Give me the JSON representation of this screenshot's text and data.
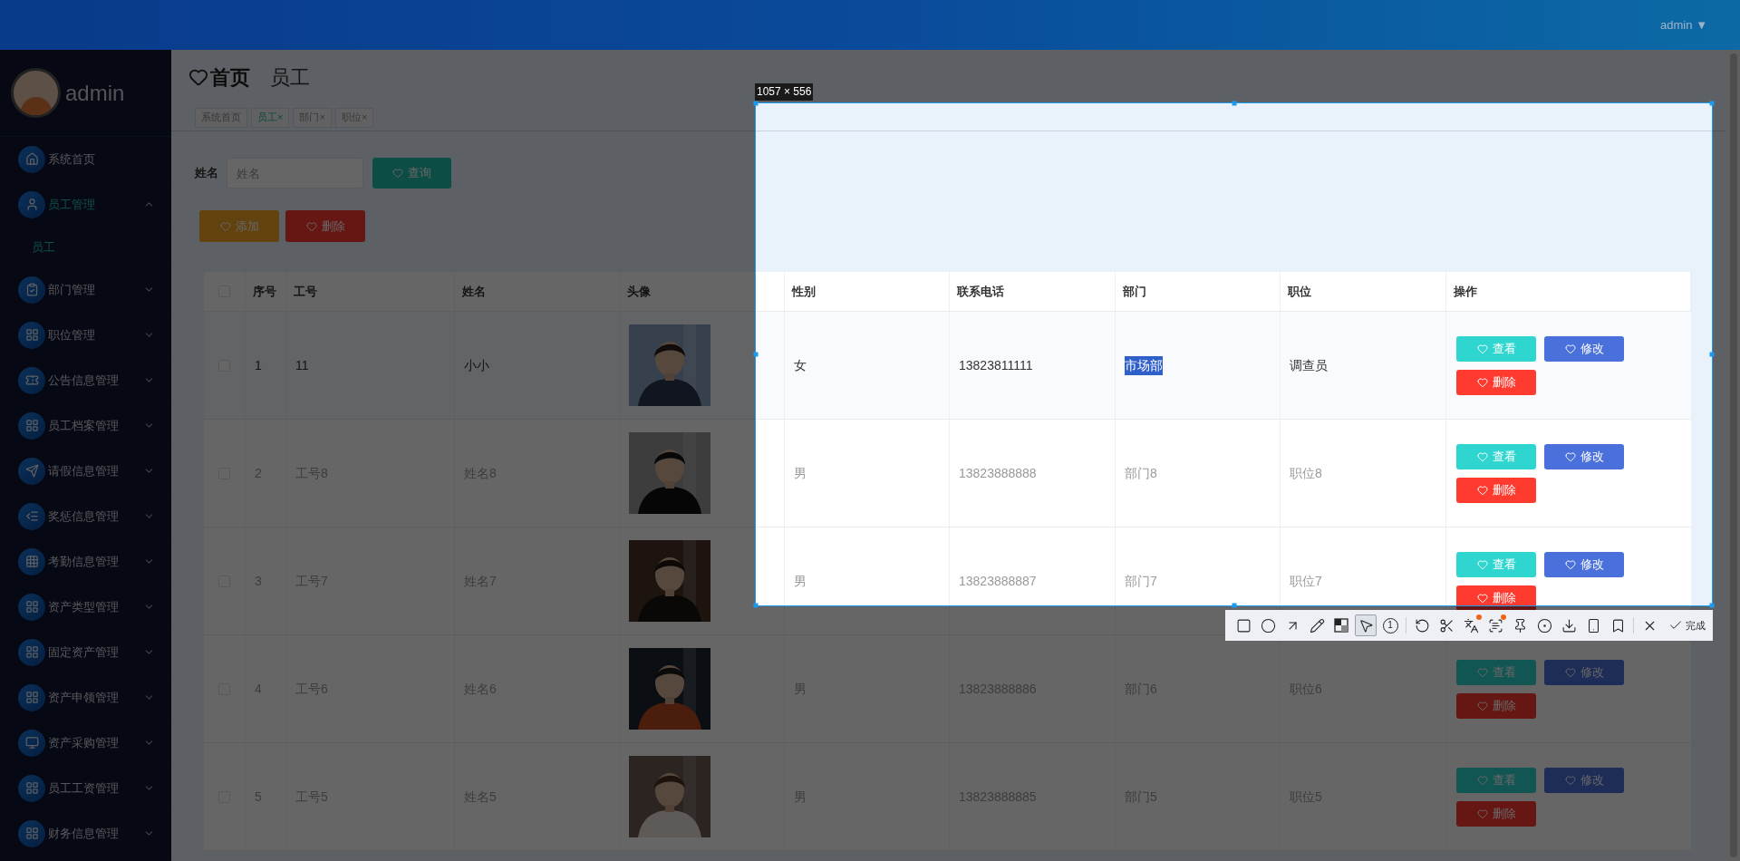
{
  "topbar": {
    "user": "admin",
    "caret": "▼"
  },
  "sidebar": {
    "username": "admin",
    "items": [
      {
        "label": "系统首页",
        "kind": "home",
        "expandable": false,
        "expanded": false,
        "selected": false
      },
      {
        "label": "员工管理",
        "kind": "user",
        "expandable": true,
        "expanded": true,
        "selected": true,
        "children": [
          {
            "label": "员工",
            "selected": true
          }
        ]
      },
      {
        "label": "部门管理",
        "kind": "clipboard",
        "expandable": true,
        "expanded": false,
        "selected": false
      },
      {
        "label": "职位管理",
        "kind": "grid",
        "expandable": true,
        "expanded": false,
        "selected": false
      },
      {
        "label": "公告信息管理",
        "kind": "ticket",
        "expandable": true,
        "expanded": false,
        "selected": false
      },
      {
        "label": "员工档案管理",
        "kind": "grid",
        "expandable": true,
        "expanded": false,
        "selected": false
      },
      {
        "label": "请假信息管理",
        "kind": "send",
        "expandable": true,
        "expanded": false,
        "selected": false
      },
      {
        "label": "奖惩信息管理",
        "kind": "list",
        "expandable": true,
        "expanded": false,
        "selected": false
      },
      {
        "label": "考勤信息管理",
        "kind": "grid9",
        "expandable": true,
        "expanded": false,
        "selected": false
      },
      {
        "label": "资产类型管理",
        "kind": "grid",
        "expandable": true,
        "expanded": false,
        "selected": false
      },
      {
        "label": "固定资产管理",
        "kind": "grid",
        "expandable": true,
        "expanded": false,
        "selected": false
      },
      {
        "label": "资产申领管理",
        "kind": "grid",
        "expandable": true,
        "expanded": false,
        "selected": false
      },
      {
        "label": "资产采购管理",
        "kind": "monitor",
        "expandable": true,
        "expanded": false,
        "selected": false
      },
      {
        "label": "员工工资管理",
        "kind": "grid",
        "expandable": true,
        "expanded": false,
        "selected": false
      },
      {
        "label": "财务信息管理",
        "kind": "grid",
        "expandable": true,
        "expanded": false,
        "selected": false
      }
    ]
  },
  "page_title": {
    "home": "首页",
    "current": "员工"
  },
  "tabs": [
    {
      "label": "系统首页",
      "selected": false
    },
    {
      "label": "员工",
      "close": "×",
      "selected": true
    },
    {
      "label": "部门",
      "close": "×",
      "selected": false
    },
    {
      "label": "职位",
      "close": "×",
      "selected": false
    }
  ],
  "search": {
    "label": "姓名",
    "placeholder": "姓名",
    "button": "查询"
  },
  "actions": [
    {
      "label": "添加",
      "kind": "add"
    },
    {
      "label": "删除",
      "kind": "delete"
    }
  ],
  "table": {
    "all_checked": false,
    "columns": [
      "序号",
      "工号",
      "姓名",
      "头像",
      "性别",
      "联系电话",
      "部门",
      "职位",
      "操作"
    ],
    "rows": [
      {
        "checked": false,
        "highlighted": true,
        "dept_text_selected": true,
        "index": "1",
        "emp_no": "11",
        "name": "小小",
        "gender": "女",
        "phone": "13823811111",
        "dept": "市场部",
        "position": "调查员",
        "actions": [
          {
            "label": "查看",
            "kind": "view"
          },
          {
            "label": "修改",
            "kind": "edit"
          },
          {
            "label": "删除",
            "kind": "delete"
          }
        ]
      },
      {
        "checked": false,
        "highlighted": false,
        "dept_text_selected": false,
        "index": "2",
        "emp_no": "工号8",
        "name": "姓名8",
        "gender": "男",
        "phone": "13823888888",
        "dept": "部门8",
        "position": "职位8",
        "actions": [
          {
            "label": "查看",
            "kind": "view"
          },
          {
            "label": "修改",
            "kind": "edit"
          },
          {
            "label": "删除",
            "kind": "delete"
          }
        ]
      },
      {
        "checked": false,
        "highlighted": false,
        "dept_text_selected": false,
        "index": "3",
        "emp_no": "工号7",
        "name": "姓名7",
        "gender": "男",
        "phone": "13823888887",
        "dept": "部门7",
        "position": "职位7",
        "actions": [
          {
            "label": "查看",
            "kind": "view"
          },
          {
            "label": "修改",
            "kind": "edit"
          },
          {
            "label": "删除",
            "kind": "delete"
          }
        ]
      },
      {
        "checked": false,
        "highlighted": false,
        "dept_text_selected": false,
        "index": "4",
        "emp_no": "工号6",
        "name": "姓名6",
        "gender": "男",
        "phone": "13823888886",
        "dept": "部门6",
        "position": "职位6",
        "actions": [
          {
            "label": "查看",
            "kind": "view"
          },
          {
            "label": "修改",
            "kind": "edit"
          },
          {
            "label": "删除",
            "kind": "delete"
          }
        ]
      },
      {
        "checked": false,
        "highlighted": false,
        "dept_text_selected": false,
        "index": "5",
        "emp_no": "工号5",
        "name": "姓名5",
        "gender": "男",
        "phone": "13823888885",
        "dept": "部门5",
        "position": "职位5",
        "actions": [
          {
            "label": "查看",
            "kind": "view"
          },
          {
            "label": "修改",
            "kind": "edit"
          },
          {
            "label": "删除",
            "kind": "delete"
          }
        ]
      }
    ]
  },
  "capture": {
    "size_label": "1057 × 556",
    "done": "完成",
    "tools": [
      {
        "kind": "rectangle",
        "selected": false,
        "dot": false
      },
      {
        "kind": "ellipse",
        "selected": false,
        "dot": false
      },
      {
        "kind": "arrow",
        "selected": false,
        "dot": false
      },
      {
        "kind": "pencil",
        "selected": false,
        "dot": false
      },
      {
        "kind": "mosaic",
        "selected": false,
        "dot": false
      },
      {
        "kind": "cursor",
        "selected": true,
        "dot": false
      },
      {
        "kind": "number",
        "glyph": "1",
        "selected": false,
        "dot": false
      },
      {
        "kind": "separator"
      },
      {
        "kind": "undo",
        "selected": false,
        "dot": false
      },
      {
        "kind": "scissors",
        "selected": false,
        "dot": false
      },
      {
        "kind": "translate",
        "selected": false,
        "dot": true
      },
      {
        "kind": "ocr",
        "selected": false,
        "dot": true
      },
      {
        "kind": "pin",
        "selected": false,
        "dot": false
      },
      {
        "kind": "record",
        "selected": false,
        "dot": false
      },
      {
        "kind": "download",
        "selected": false,
        "dot": false
      },
      {
        "kind": "phone",
        "selected": false,
        "dot": false
      },
      {
        "kind": "bookmark",
        "selected": false,
        "dot": false
      },
      {
        "kind": "separator"
      },
      {
        "kind": "close",
        "selected": false,
        "dot": false
      }
    ]
  }
}
